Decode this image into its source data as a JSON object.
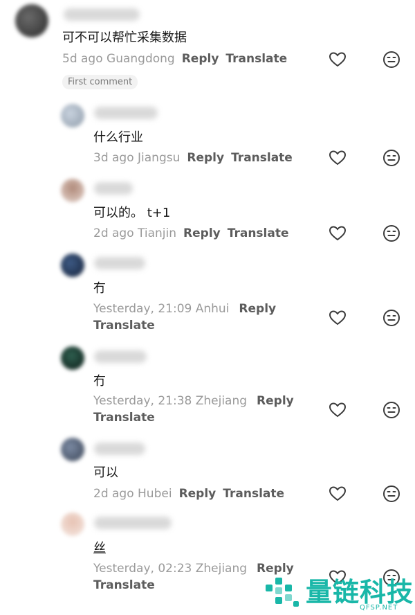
{
  "comments": [
    {
      "text": "可不可以帮忙采集数据",
      "meta": "5d ago Guangdong",
      "reply": "Reply",
      "translate": "Translate",
      "badge": "First comment"
    },
    {
      "text": "什么行业",
      "meta": "3d ago Jiangsu",
      "reply": "Reply",
      "translate": "Translate"
    },
    {
      "text": "可以的。 t+1",
      "meta": "2d ago Tianjin",
      "reply": "Reply",
      "translate": "Translate"
    },
    {
      "text": "冇",
      "meta": "Yesterday, 21:09 Anhui",
      "reply": "Reply",
      "translate": "Translate"
    },
    {
      "text": "冇",
      "meta": "Yesterday, 21:38 Zhejiang",
      "reply": "Reply",
      "translate": "Translate"
    },
    {
      "text": "可以",
      "meta": "2d ago Hubei",
      "reply": "Reply",
      "translate": "Translate"
    },
    {
      "text": "丝",
      "meta": "Yesterday, 02:23 Zhejiang",
      "reply": "Reply",
      "translate": "Translate"
    }
  ],
  "icons": {
    "like": "heart-outline-icon",
    "dislike": "neutral-face-icon"
  },
  "watermark": {
    "title": "量链科技",
    "subtitle": "QFSP.NET",
    "color": "#19b7a8"
  }
}
